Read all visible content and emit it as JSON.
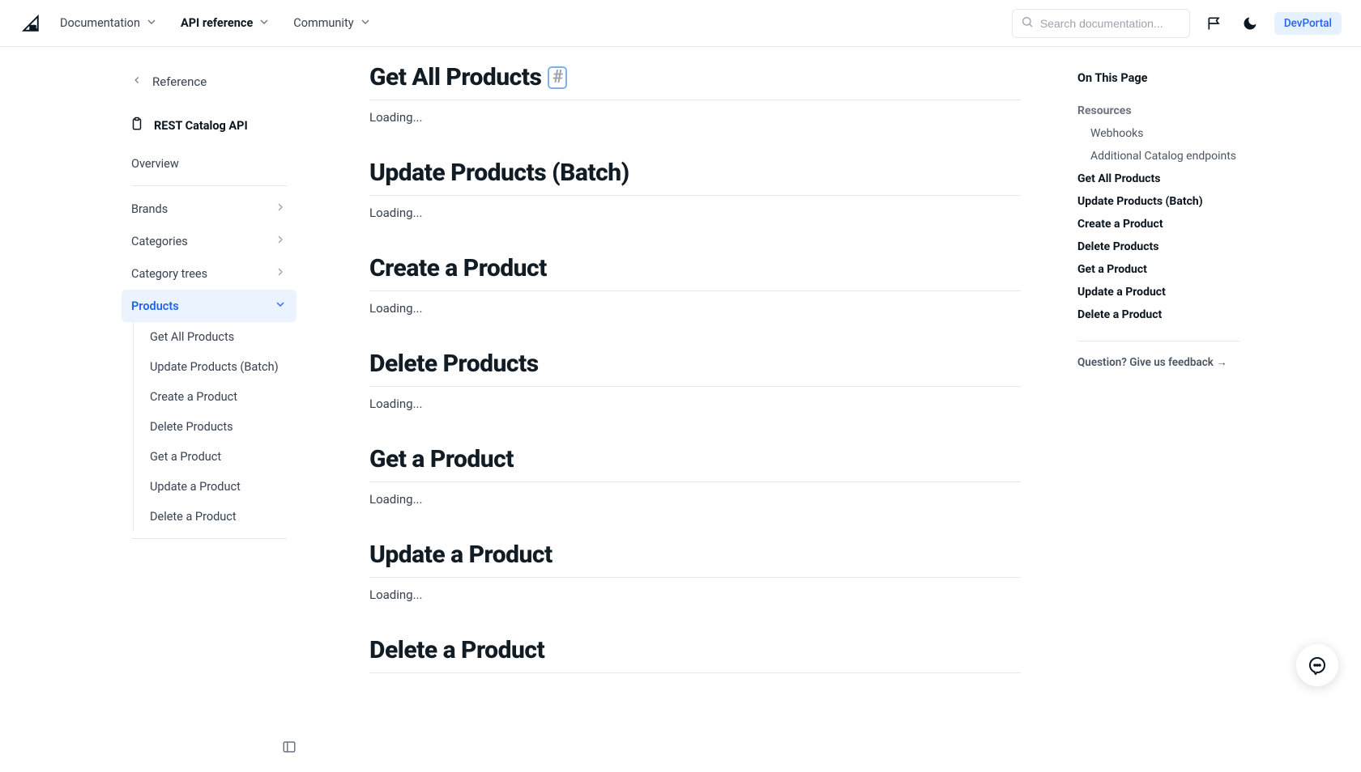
{
  "header": {
    "nav": {
      "documentation": "Documentation",
      "api_reference": "API reference",
      "community": "Community"
    },
    "search_placeholder": "Search documentation...",
    "devportal": "DevPortal"
  },
  "sidebar": {
    "back": "Reference",
    "api_title": "REST Catalog API",
    "overview": "Overview",
    "items": [
      {
        "label": "Brands"
      },
      {
        "label": "Categories"
      },
      {
        "label": "Category trees"
      },
      {
        "label": "Products",
        "active": true,
        "open": true
      }
    ],
    "products_sub": [
      "Get All Products",
      "Update Products (Batch)",
      "Create a Product",
      "Delete Products",
      "Get a Product",
      "Update a Product",
      "Delete a Product"
    ]
  },
  "main": {
    "loading": "Loading...",
    "sections": [
      {
        "title": "Get All Products",
        "anchor": true
      },
      {
        "title": "Update Products (Batch)"
      },
      {
        "title": "Create a Product"
      },
      {
        "title": "Delete Products"
      },
      {
        "title": "Get a Product"
      },
      {
        "title": "Update a Product"
      },
      {
        "title": "Delete a Product"
      }
    ]
  },
  "toc": {
    "title": "On This Page",
    "items": [
      {
        "label": "Resources",
        "bold": true,
        "gray": true
      },
      {
        "label": "Webhooks",
        "sub": true
      },
      {
        "label": "Additional Catalog endpoints",
        "sub": true
      },
      {
        "label": "Get All Products",
        "bold": true
      },
      {
        "label": "Update Products (Batch)",
        "bold": true
      },
      {
        "label": "Create a Product",
        "bold": true
      },
      {
        "label": "Delete Products",
        "bold": true
      },
      {
        "label": "Get a Product",
        "bold": true
      },
      {
        "label": "Update a Product",
        "bold": true
      },
      {
        "label": "Delete a Product",
        "bold": true
      }
    ],
    "feedback": "Question? Give us feedback →"
  },
  "anchor_symbol": "#"
}
